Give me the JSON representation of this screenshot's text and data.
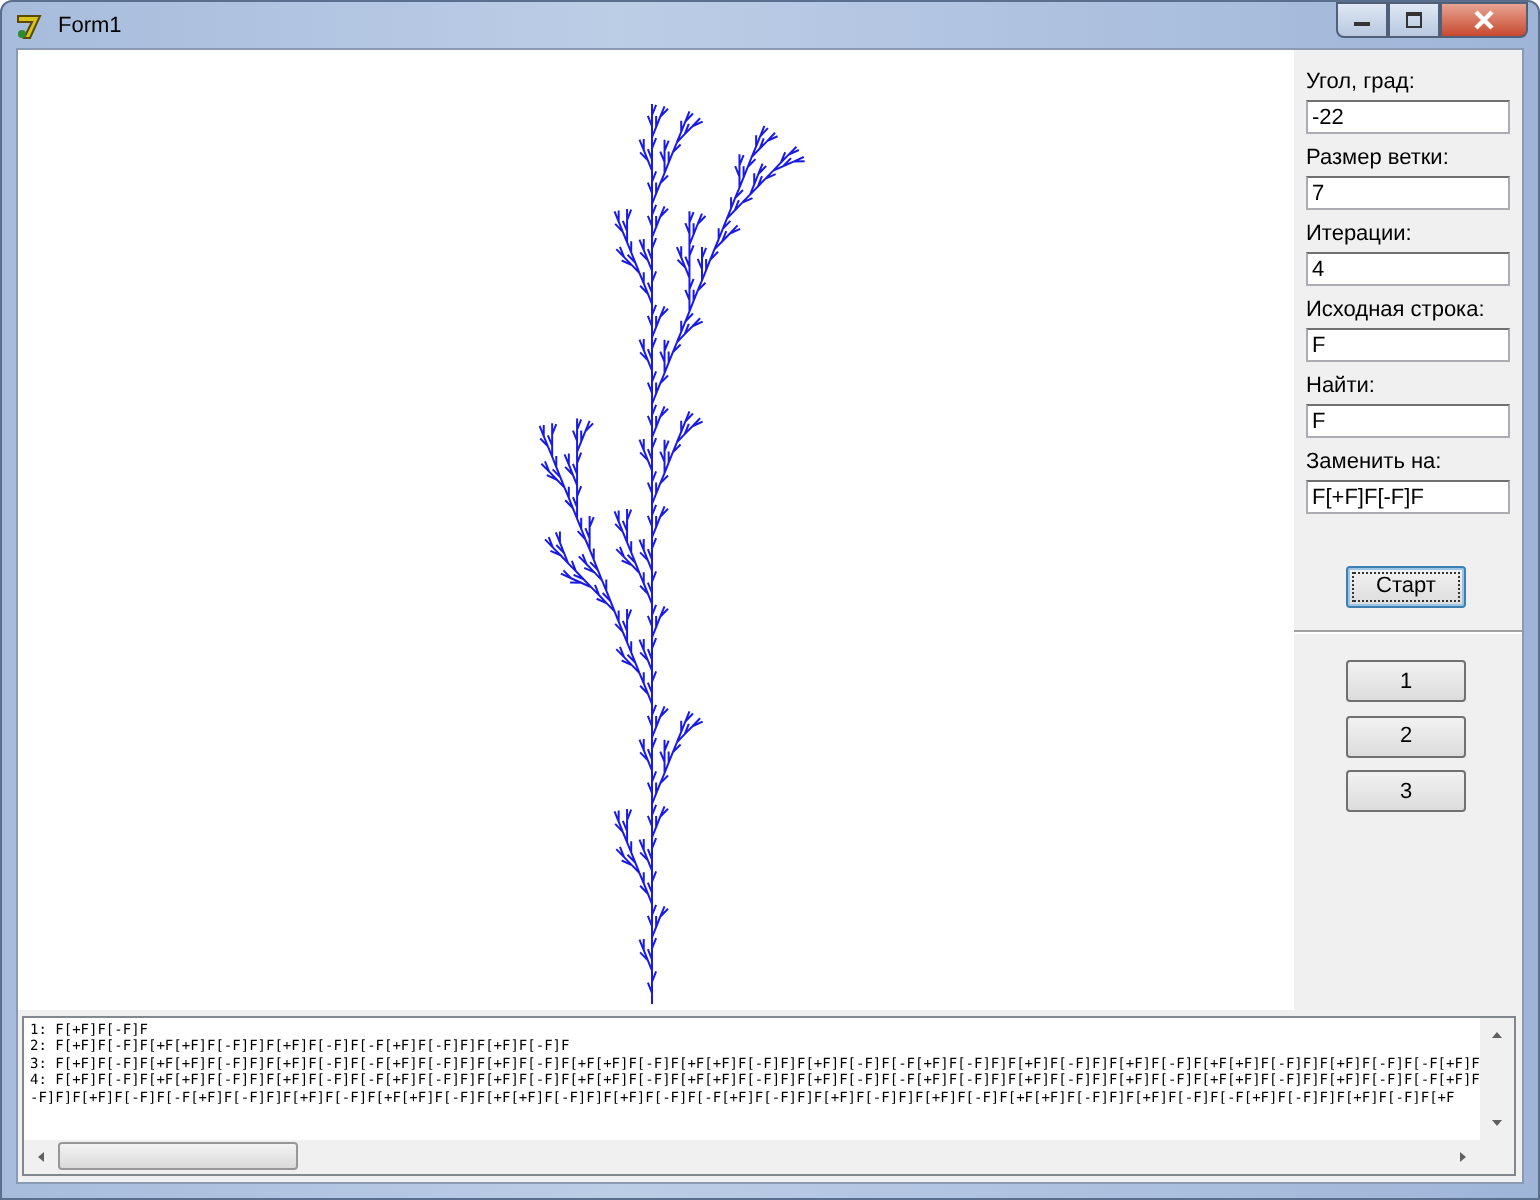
{
  "window": {
    "title": "Form1"
  },
  "parameters": [
    {
      "kind": "angle",
      "label": "Угол, град:",
      "value": "-22"
    },
    {
      "kind": "size",
      "label": "Размер ветки:",
      "value": "7"
    },
    {
      "kind": "iterations",
      "label": "Итерации:",
      "value": "4"
    },
    {
      "kind": "axiom",
      "label": "Исходная строка:",
      "value": "F"
    },
    {
      "kind": "find",
      "label": "Найти:",
      "value": "F"
    },
    {
      "kind": "replace",
      "label": "Заменить на:",
      "value": "F[+F]F[-F]F"
    }
  ],
  "start_button": "Старт",
  "preset_buttons": [
    "1",
    "2",
    "3"
  ],
  "output": {
    "lines": [
      "1: F[+F]F[-F]F",
      "2: F[+F]F[-F]F[+F[+F]F[-F]F]F[+F]F[-F]F[-F[+F]F[-F]F]F[+F]F[-F]F",
      "3: F[+F]F[-F]F[+F[+F]F[-F]F]F[+F]F[-F]F[-F[+F]F[-F]F]F[+F]F[-F]F[+F[+F]F[-F]F[+F[+F]F[-F]F]F[+F]F[-F]F[-F[+F]F[-F]F]F[+F]F[-F]F]F[+F]F[-F]F[+F[+F]F[-F]F]F[+F]F[-F]F[-F[+F]F",
      "4: F[+F]F[-F]F[+F[+F]F[-F]F]F[+F]F[-F]F[-F[+F]F[-F]F]F[+F]F[-F]F[+F[+F]F[-F]F[+F[+F]F[-F]F]F[+F]F[-F]F[-F[+F]F[-F]F]F[+F]F[-F]F]F[+F]F[-F]F[+F[+F]F[-F]F]F[+F]F[-F]F[-F[+F]F",
      "-F]F]F[+F]F[-F]F[-F[+F]F[-F]F]F[+F]F[-F]F[+F[+F]F[-F]F[+F[+F]F[-F]F]F[+F]F[-F]F[-F[+F]F[-F]F]F[+F]F[-F]F]F[+F]F[-F]F[+F[+F]F[-F]F]F[+F]F[-F]F[-F[+F]F[-F]F]F[+F]F[-F]F[+F"
    ]
  }
}
